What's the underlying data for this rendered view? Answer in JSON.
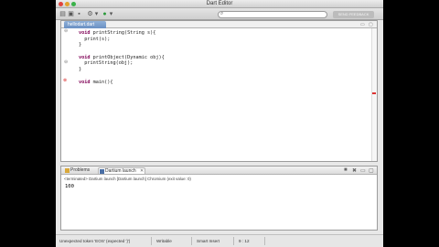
{
  "window": {
    "title": "Dart Editor"
  },
  "editor": {
    "tab_label": "hellodart.dart",
    "lines": [
      "void printString(String s){",
      "  print(s);",
      "}",
      "",
      "void printObject(Dynamic obj){",
      "  printString(obj);",
      "}",
      "",
      "void main(){",
      "",
      "",
      "",
      "",
      "",
      "",
      "",
      "",
      "",
      "",
      ""
    ]
  },
  "console": {
    "tabs": [
      {
        "label": "Problems",
        "active": false
      },
      {
        "label": "Dartium launch",
        "active": true
      }
    ],
    "status": "<terminated> Dartium launch [Dartium launch] Chromium (exit value: 0)",
    "output": "100"
  },
  "statusbar": {
    "message": "Unexpected token 'EOS' (expected '}')",
    "writable": "Writable",
    "insert_mode": "Smart Insert",
    "position": "9 : 12"
  },
  "toolbar": {
    "send_feedback": "SEND FEEDBACK"
  },
  "colors": {
    "keyword": "#7f0055",
    "error": "#d33333",
    "tab_active": "#6a90c3"
  }
}
